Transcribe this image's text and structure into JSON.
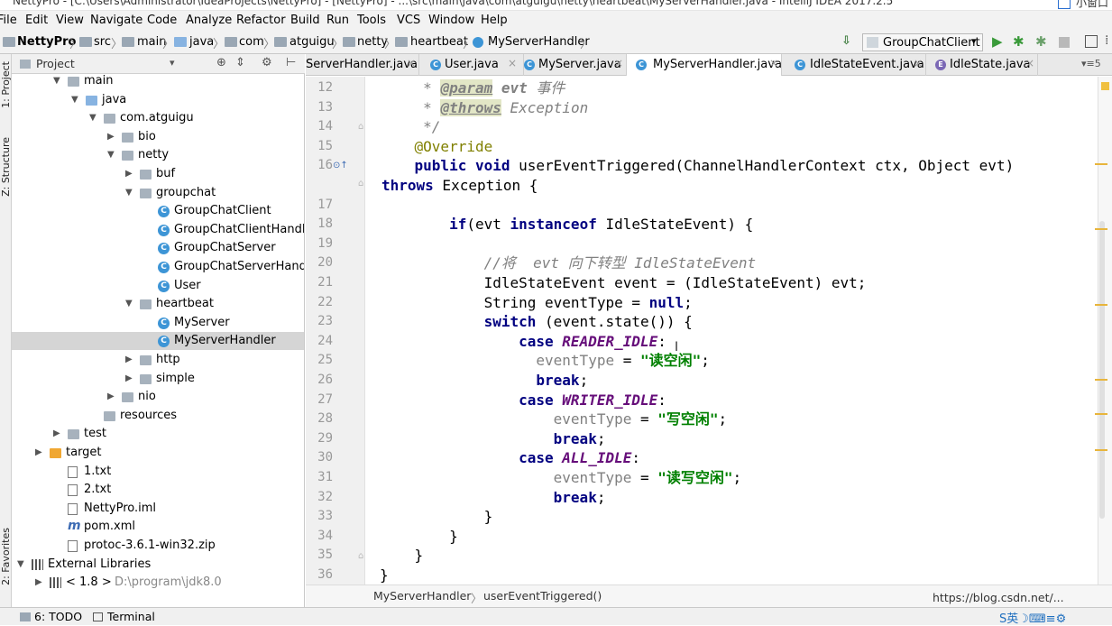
{
  "window": {
    "title": "NettyPro - [C:\\Users\\Administrator\\IdeaProjects\\NettyPro] - [NettyPro] - ...\\src\\main\\java\\com\\atguigu\\netty\\heartbeat\\MyServerHandler.java - IntelliJ IDEA 2017.2.5",
    "side_label": "小窗口"
  },
  "menu": [
    "File",
    "Edit",
    "View",
    "Navigate",
    "Code",
    "Analyze",
    "Refactor",
    "Build",
    "Run",
    "Tools",
    "VCS",
    "Window",
    "Help"
  ],
  "breadcrumbs": [
    "NettyPro",
    "src",
    "main",
    "java",
    "com",
    "atguigu",
    "netty",
    "heartbeat",
    "MyServerHandler"
  ],
  "run_config": "GroupChatClient",
  "left_stripe": {
    "project": "1: Project",
    "structure": "Z: Structure",
    "favorites": "2: Favorites"
  },
  "project_panel": {
    "title": "Project"
  },
  "tree": [
    {
      "label": "main",
      "depth": 2,
      "arrow": "down",
      "icon": "folder"
    },
    {
      "label": "java",
      "depth": 3,
      "arrow": "down",
      "icon": "folder-blue"
    },
    {
      "label": "com.atguigu",
      "depth": 4,
      "arrow": "down",
      "icon": "package"
    },
    {
      "label": "bio",
      "depth": 5,
      "arrow": "right",
      "icon": "package"
    },
    {
      "label": "netty",
      "depth": 5,
      "arrow": "down",
      "icon": "package"
    },
    {
      "label": "buf",
      "depth": 6,
      "arrow": "right",
      "icon": "package"
    },
    {
      "label": "groupchat",
      "depth": 6,
      "arrow": "down",
      "icon": "package"
    },
    {
      "label": "GroupChatClient",
      "depth": 7,
      "arrow": "",
      "icon": "class"
    },
    {
      "label": "GroupChatClientHandler",
      "depth": 7,
      "arrow": "",
      "icon": "class"
    },
    {
      "label": "GroupChatServer",
      "depth": 7,
      "arrow": "",
      "icon": "class"
    },
    {
      "label": "GroupChatServerHandler",
      "depth": 7,
      "arrow": "",
      "icon": "class"
    },
    {
      "label": "User",
      "depth": 7,
      "arrow": "",
      "icon": "class"
    },
    {
      "label": "heartbeat",
      "depth": 6,
      "arrow": "down",
      "icon": "package"
    },
    {
      "label": "MyServer",
      "depth": 7,
      "arrow": "",
      "icon": "class"
    },
    {
      "label": "MyServerHandler",
      "depth": 7,
      "arrow": "",
      "icon": "class",
      "selected": true
    },
    {
      "label": "http",
      "depth": 6,
      "arrow": "right",
      "icon": "package"
    },
    {
      "label": "simple",
      "depth": 6,
      "arrow": "right",
      "icon": "package"
    },
    {
      "label": "nio",
      "depth": 5,
      "arrow": "right",
      "icon": "package"
    },
    {
      "label": "resources",
      "depth": 4,
      "arrow": "",
      "icon": "folder"
    },
    {
      "label": "test",
      "depth": 2,
      "arrow": "right",
      "icon": "folder"
    },
    {
      "label": "target",
      "depth": 1,
      "arrow": "right",
      "icon": "folder-orange"
    },
    {
      "label": "1.txt",
      "depth": 2,
      "arrow": "",
      "icon": "file"
    },
    {
      "label": "2.txt",
      "depth": 2,
      "arrow": "",
      "icon": "file"
    },
    {
      "label": "NettyPro.iml",
      "depth": 2,
      "arrow": "",
      "icon": "file"
    },
    {
      "label": "pom.xml",
      "depth": 2,
      "arrow": "",
      "icon": "maven"
    },
    {
      "label": "protoc-3.6.1-win32.zip",
      "depth": 2,
      "arrow": "",
      "icon": "file"
    },
    {
      "label": "External Libraries",
      "depth": 0,
      "arrow": "down",
      "icon": "library"
    },
    {
      "label": "< 1.8 >",
      "depth": 1,
      "arrow": "right",
      "icon": "library",
      "extra": "D:\\program\\jdk8.0"
    }
  ],
  "tabs": [
    {
      "label": "ServerHandler.java",
      "active": false
    },
    {
      "label": "User.java",
      "active": false
    },
    {
      "label": "MyServer.java",
      "active": false
    },
    {
      "label": "MyServerHandler.java",
      "active": true
    },
    {
      "label": "IdleStateEvent.java",
      "active": false
    },
    {
      "label": "IdleState.java",
      "active": false
    }
  ],
  "tabs_overflow": "▾≡5",
  "code_lines": [
    {
      "n": "12",
      "t": "     * @param evt 事件"
    },
    {
      "n": "13",
      "t": "     * @throws Exception"
    },
    {
      "n": "14",
      "t": "     */"
    },
    {
      "n": "15",
      "t": "    @Override"
    },
    {
      "n": "16",
      "t": "    public void userEventTriggered(ChannelHandlerContext ctx, Object evt)"
    },
    {
      "n": "",
      "t": "throws Exception {"
    },
    {
      "n": "17",
      "t": ""
    },
    {
      "n": "18",
      "t": "        if(evt instanceof IdleStateEvent) {"
    },
    {
      "n": "19",
      "t": ""
    },
    {
      "n": "20",
      "t": "            //将  evt 向下转型 IdleStateEvent"
    },
    {
      "n": "21",
      "t": "            IdleStateEvent event = (IdleStateEvent) evt;"
    },
    {
      "n": "22",
      "t": "            String eventType = null;"
    },
    {
      "n": "23",
      "t": "            switch (event.state()) {"
    },
    {
      "n": "24",
      "t": "                case READER_IDLE:"
    },
    {
      "n": "25",
      "t": "                  eventType = \"读空闲\";"
    },
    {
      "n": "26",
      "t": "                  break;"
    },
    {
      "n": "27",
      "t": "                case WRITER_IDLE:"
    },
    {
      "n": "28",
      "t": "                    eventType = \"写空闲\";"
    },
    {
      "n": "29",
      "t": "                    break;"
    },
    {
      "n": "30",
      "t": "                case ALL_IDLE:"
    },
    {
      "n": "31",
      "t": "                    eventType = \"读写空闲\";"
    },
    {
      "n": "32",
      "t": "                    break;"
    },
    {
      "n": "33",
      "t": "            }"
    },
    {
      "n": "34",
      "t": "        }"
    },
    {
      "n": "35",
      "t": "    }"
    },
    {
      "n": "36",
      "t": "}"
    }
  ],
  "editor_crumbs": [
    "MyServerHandler",
    "userEventTriggered()"
  ],
  "status": {
    "todo": "6: TODO",
    "terminal": "Terminal"
  },
  "watermark": "https://blog.csdn.net/..."
}
